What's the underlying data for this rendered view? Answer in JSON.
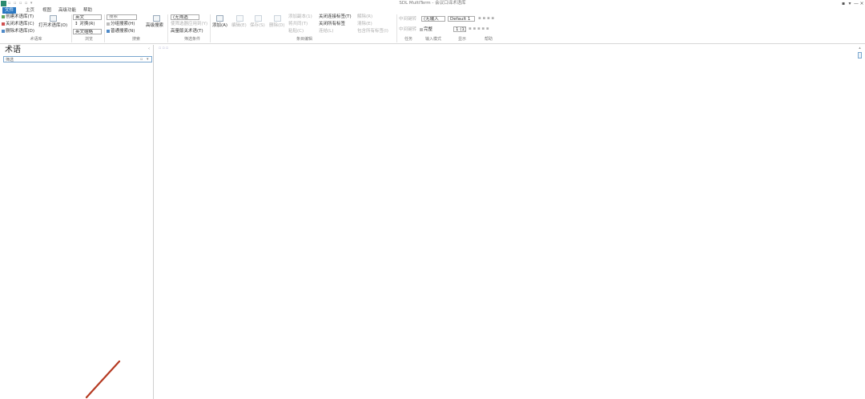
{
  "app": {
    "window_title": "SDL MultiTerm - 会议口译术语库",
    "quick_access": "▫ ▫ ▫ ▫ ▾",
    "window_buttons": [
      "▪",
      "▾",
      "—",
      "×"
    ]
  },
  "menu": [
    "文件",
    "主页",
    "视图",
    "高级功能",
    "帮助"
  ],
  "ribbon": {
    "termbase": {
      "create": "创建术语库(T)",
      "close": "关闭术语库(C)",
      "delete": "删除术语库(D)",
      "open": "打开术语库(O)",
      "group": "术语库"
    },
    "browse": {
      "lang": "英文",
      "sort": "↕ 对换(R)",
      "target": "英文缩略",
      "group": "浏览"
    },
    "search": {
      "placeholder": "搜索",
      "split": "分组搜索(H)",
      "normal": "普通搜索(N)",
      "advanced": "高级搜索",
      "group": "搜索"
    },
    "filter": {
      "none": "(无筛选",
      "apply_results": "使筛选器应用到(Y)",
      "highlight": "高量版关术语(T)",
      "group": "筛选条件"
    },
    "entry": {
      "add": "添加(A)",
      "edit": "编辑(E)",
      "save": "保存(S)",
      "delete": "删除(D)",
      "group": "条目编辑"
    },
    "edit_ops": {
      "col1": [
        "添加副本(1)",
        "将共同(T)",
        "粘贴(C)"
      ],
      "col2_a": "关闭连接标签(T)",
      "col2_b": "关闭所有标签",
      "col2_c": "连结(L)",
      "col3": [
        "解除(R)",
        "清除(E)",
        "包含所有标签(I)"
      ]
    },
    "task": {
      "label": "中间键转",
      "group": "任务"
    },
    "input": {
      "mode": "(无输入",
      "complete": "完整",
      "default_label": "Default 1",
      "group": "输入模式"
    },
    "display": {
      "size": "1 (1)",
      "group": "显示"
    },
    "help": {
      "group": "帮助"
    }
  },
  "left_panel": {
    "title": "术语",
    "search_value": "筛选"
  },
  "main": {
    "hint": "▫ ▫ ▫"
  },
  "colors": {
    "accent": "#2b78c2",
    "annotation": "#b53a22"
  }
}
